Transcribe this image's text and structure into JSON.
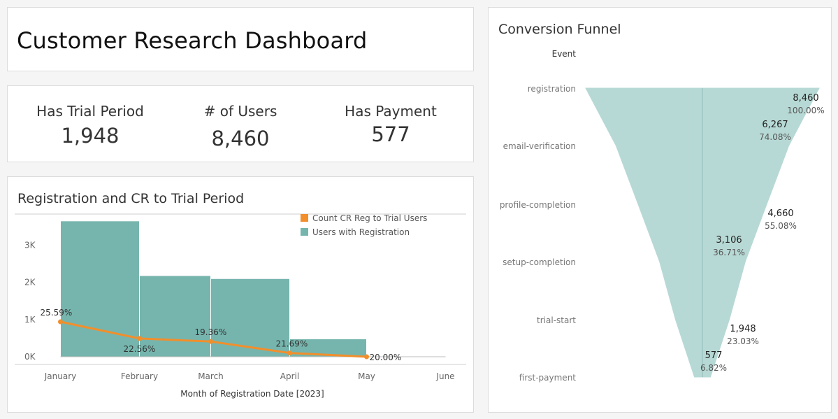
{
  "title": "Customer Research Dashboard",
  "kpis": {
    "trial": {
      "label": "Has Trial Period",
      "value": "1,948"
    },
    "users": {
      "label": "# of Users",
      "value": "8,460"
    },
    "payment": {
      "label": "Has Payment",
      "value": "577"
    }
  },
  "colors": {
    "bar": "#76b5ad",
    "line": "#f28e2b",
    "funnel": "#b7d9d5"
  },
  "chart_data": [
    {
      "type": "bar",
      "title": "Registration and CR to Trial Period",
      "xlabel": "Month of Registration Date [2023]",
      "categories": [
        "January",
        "February",
        "March",
        "April",
        "May",
        "June"
      ],
      "yticks": [
        "0K",
        "1K",
        "2K",
        "3K"
      ],
      "ylim": [
        0,
        3650
      ],
      "legend": [
        "Count CR Reg to Trial Users",
        "Users with Registration"
      ],
      "series": [
        {
          "name": "Users with Registration",
          "values": [
            3650,
            2180,
            2100,
            480,
            0
          ]
        },
        {
          "name": "Count CR Reg to Trial Users",
          "values": [
            25.59,
            22.56,
            19.36,
            21.69,
            20.0
          ],
          "labels": [
            "25.59%",
            "22.56%",
            "19.36%",
            "21.69%",
            "20.00%"
          ],
          "points_k": [
            0.94,
            0.49,
            0.41,
            0.1,
            0.0
          ]
        }
      ]
    },
    {
      "type": "funnel",
      "title": "Conversion Funnel",
      "ylabel": "Event",
      "stages": [
        "registration",
        "email-verification",
        "profile-completion",
        "setup-completion",
        "trial-start",
        "first-payment"
      ],
      "values": [
        8460,
        6267,
        4660,
        3106,
        1948,
        577
      ],
      "value_labels": [
        "8,460",
        "6,267",
        "4,660",
        "3,106",
        "1,948",
        "577"
      ],
      "percent_labels": [
        "100.00%",
        "74.08%",
        "55.08%",
        "36.71%",
        "23.03%",
        "6.82%"
      ]
    }
  ]
}
